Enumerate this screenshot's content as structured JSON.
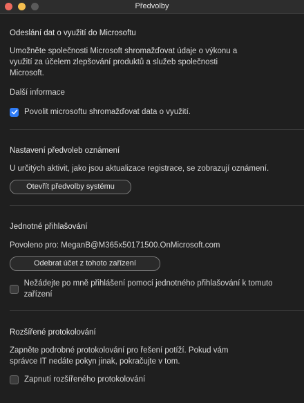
{
  "window": {
    "title": "Předvolby"
  },
  "data_sharing": {
    "heading": "Odeslání dat o využití do Microsoftu",
    "description": "Umožněte společnosti Microsoft shromažďovat údaje o výkonu a využití za účelem zlepšování produktů a služeb společnosti Microsoft.",
    "more_info": "Další informace",
    "allow_checkbox_label": "Povolit microsoftu shromažďovat data o využití.",
    "allow_checked": true
  },
  "notifications": {
    "heading": "Nastavení předvoleb oznámení",
    "description": "U určitých aktivit, jako jsou aktualizace registrace, se zobrazují oznámení.",
    "open_button": "Otevřít předvolby systému"
  },
  "sso": {
    "heading": "Jednotné přihlašování",
    "enabled_for": "Povoleno pro: MeganB@M365x50171500.OnMicrosoft.com",
    "remove_button": "Odebrat účet z tohoto zařízení",
    "dont_ask_label": "Nežádejte po mně přihlášení pomocí jednotného přihlašování k tomuto zařízení",
    "dont_ask_checked": false
  },
  "logging": {
    "heading": "Rozšířené protokolování",
    "description": "Zapněte podrobné protokolování pro řešení potíží. Pokud vám správce IT nedáte pokyn jinak, pokračujte v tom.",
    "enable_label": "Zapnutí rozšířeného protokolování",
    "enable_checked": false
  }
}
